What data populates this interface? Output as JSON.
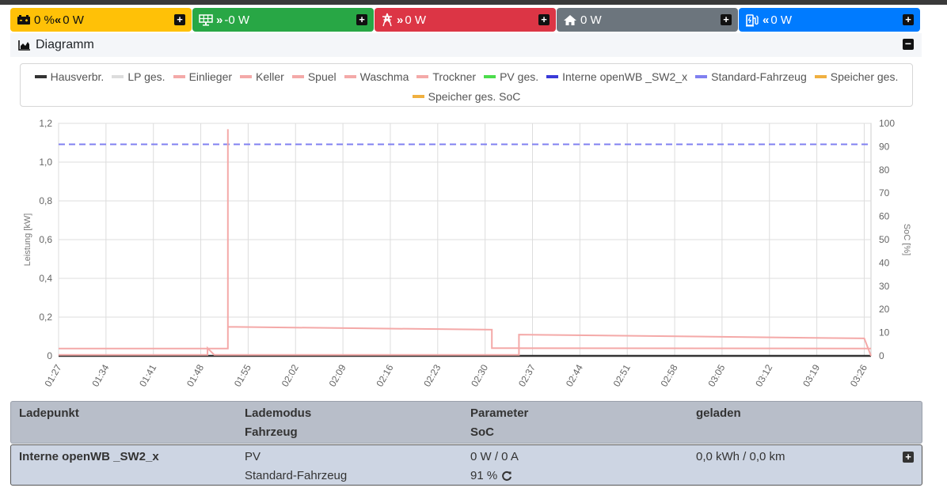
{
  "tiles": [
    {
      "label": "0 % ",
      "arrows": "«",
      "value": "0 W",
      "color": "#ffc107",
      "icon": "battery-icon"
    },
    {
      "label": "",
      "arrows": "»",
      "value": "-0 W",
      "color": "#28a745",
      "icon": "solar-panel-icon"
    },
    {
      "label": "",
      "arrows": "»",
      "value": "0 W",
      "color": "#dc3545",
      "icon": "power-tower-icon"
    },
    {
      "label": "",
      "arrows": "",
      "value": "0 W",
      "color": "#6c757d",
      "icon": "house-icon"
    },
    {
      "label": "",
      "arrows": "«",
      "value": "0 W",
      "color": "#007bff",
      "icon": "charging-station-icon"
    }
  ],
  "diagram": {
    "title": "Diagramm"
  },
  "legend": [
    {
      "name": "Hausverbr.",
      "color": "#333333"
    },
    {
      "name": "LP ges.",
      "color": "#dddddd"
    },
    {
      "name": "Einlieger",
      "color": "#f4a9a8"
    },
    {
      "name": "Keller",
      "color": "#f4a9a8"
    },
    {
      "name": "Spuel",
      "color": "#f4a9a8"
    },
    {
      "name": "Waschma",
      "color": "#f4a9a8"
    },
    {
      "name": "Trockner",
      "color": "#f4a9a8"
    },
    {
      "name": "PV ges.",
      "color": "#4cdd4c"
    },
    {
      "name": "Interne openWB _SW2_x",
      "color": "#3a3ad8"
    },
    {
      "name": "Standard-Fahrzeug",
      "color": "#8080f0"
    },
    {
      "name": "Speicher ges.",
      "color": "#f0b040"
    },
    {
      "name": "Speicher ges. SoC",
      "color": "#f0b040"
    }
  ],
  "chart_data": {
    "type": "line",
    "ylabel": "Leistung [kW]",
    "y2label": "SoC [%]",
    "ylim": [
      0,
      1.2
    ],
    "y2lim": [
      0,
      100
    ],
    "y_ticks": [
      "0",
      "0,2",
      "0,4",
      "0,6",
      "0,8",
      "1,0",
      "1,2"
    ],
    "y2_ticks": [
      "0",
      "10",
      "20",
      "30",
      "40",
      "50",
      "60",
      "70",
      "80",
      "90",
      "100"
    ],
    "x_ticks": [
      "01:27",
      "01:34",
      "01:41",
      "01:48",
      "01:55",
      "02:02",
      "02:09",
      "02:16",
      "02:23",
      "02:30",
      "02:37",
      "02:44",
      "02:51",
      "02:58",
      "03:05",
      "03:12",
      "03:19",
      "03:26"
    ],
    "series": [
      {
        "name": "Standard-Fahrzeug",
        "axis": "y2",
        "dashed": true,
        "points": [
          [
            "01:27",
            91
          ],
          [
            "03:27",
            91
          ]
        ]
      },
      {
        "name": "Hausverbr.",
        "axis": "y",
        "points": [
          [
            "01:27",
            0
          ],
          [
            "03:27",
            0
          ]
        ]
      },
      {
        "name": "Einlieger",
        "axis": "y",
        "points": [
          [
            "01:27",
            0.038
          ],
          [
            "01:52",
            0.038
          ],
          [
            "01:52",
            1.17
          ],
          [
            "01:52",
            0.15
          ],
          [
            "02:31",
            0.135
          ],
          [
            "02:31",
            0.04
          ],
          [
            "02:35",
            0.04
          ],
          [
            "02:35",
            0.11
          ],
          [
            "03:26",
            0.09
          ],
          [
            "03:27",
            0.0
          ]
        ]
      },
      {
        "name": "Keller",
        "axis": "y",
        "points": [
          [
            "01:27",
            0.005
          ],
          [
            "01:49",
            0.005
          ],
          [
            "01:49",
            0.04
          ],
          [
            "01:50",
            0.005
          ],
          [
            "02:35",
            0.005
          ],
          [
            "02:35",
            0.04
          ],
          [
            "03:27",
            0.038
          ]
        ]
      }
    ]
  },
  "table": {
    "headers": {
      "ladepunkt": "Ladepunkt",
      "lademodus": "Lademodus",
      "fahrzeug": "Fahrzeug",
      "parameter": "Parameter",
      "soc": "SoC",
      "geladen": "geladen"
    },
    "row": {
      "name": "Interne openWB _SW2_x",
      "mode": "PV",
      "vehicle": "Standard-Fahrzeug",
      "parameter": "0 W / 0 A",
      "soc": "91 %",
      "charged": "0,0 kWh / 0,0 km"
    }
  }
}
